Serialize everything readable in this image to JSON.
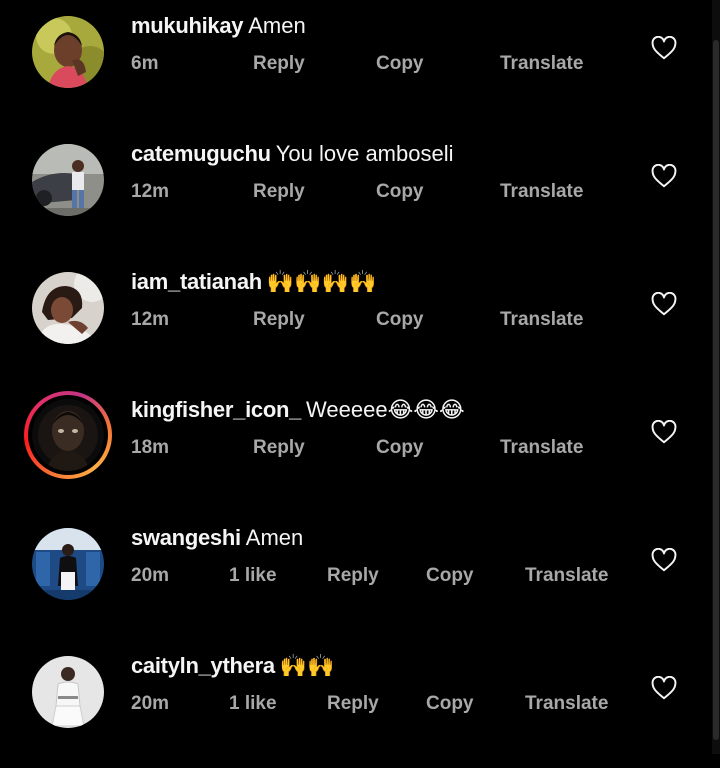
{
  "comments": [
    {
      "username": "mukuhikay",
      "text": "Amen",
      "time": "6m",
      "likes": "",
      "reply": "Reply",
      "copy": "Copy",
      "translate": "Translate"
    },
    {
      "username": "catemuguchu",
      "text": "You love amboseli",
      "time": "12m",
      "likes": "",
      "reply": "Reply",
      "copy": "Copy",
      "translate": "Translate"
    },
    {
      "username": "iam_tatianah",
      "text": "🙌🙌🙌🙌",
      "time": "12m",
      "likes": "",
      "reply": "Reply",
      "copy": "Copy",
      "translate": "Translate"
    },
    {
      "username": "kingfisher_icon_",
      "text": "Weeeee😂😂😂",
      "time": "18m",
      "likes": "",
      "reply": "Reply",
      "copy": "Copy",
      "translate": "Translate"
    },
    {
      "username": "swangeshi",
      "text": "Amen",
      "time": "20m",
      "likes": "1 like",
      "reply": "Reply",
      "copy": "Copy",
      "translate": "Translate"
    },
    {
      "username": "caityln_ythera",
      "text": "🙌🙌",
      "time": "20m",
      "likes": "1 like",
      "reply": "Reply",
      "copy": "Copy",
      "translate": "Translate"
    }
  ],
  "icons": {
    "heart": "heart-outline-icon"
  },
  "colors": {
    "background": "#000000",
    "primary_text": "#f5f5f5",
    "secondary_text": "#a8a8a8",
    "story_ring": "#e1306c"
  }
}
